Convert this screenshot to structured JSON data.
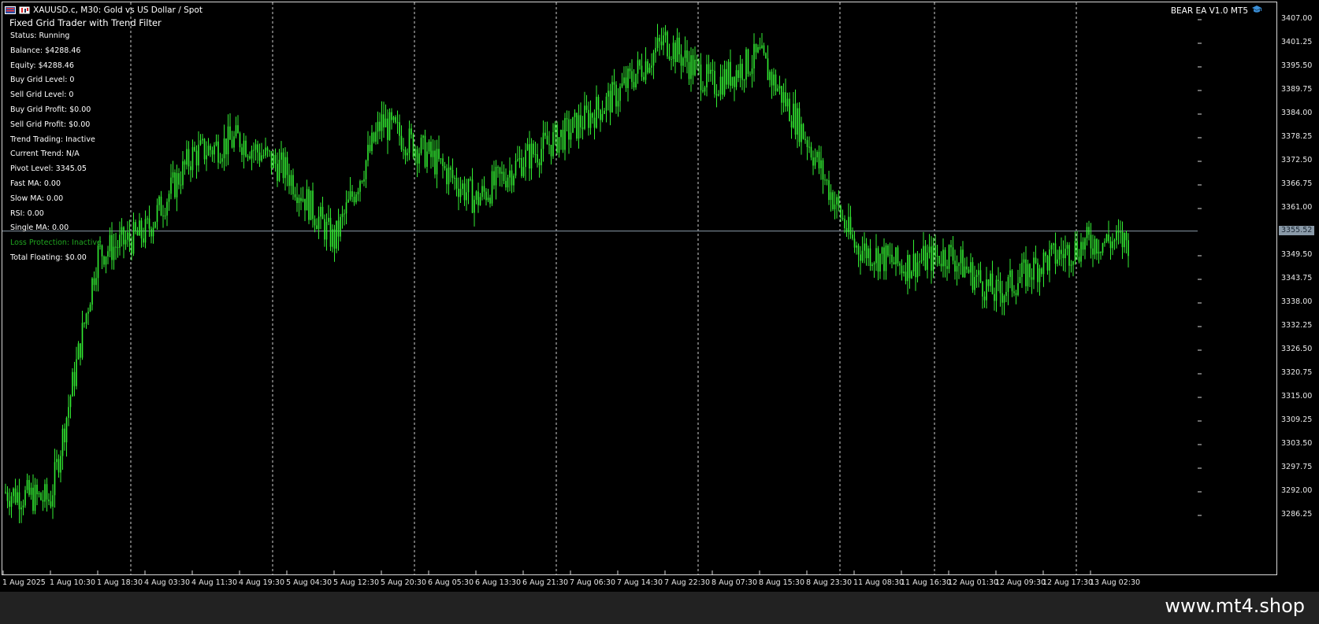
{
  "window": {
    "symbol_title": "XAUUSD.c, M30:  Gold vs US Dollar / Spot",
    "ea_badge": "BEAR EA V1.0 MT5",
    "symbol_icon": "chart-flag-icon",
    "cap_icon": "graduation-cap-icon"
  },
  "ea_panel": {
    "title": "Fixed Grid Trader with Trend Filter",
    "lines": [
      {
        "text": "Status: Running",
        "color": "#ffffff"
      },
      {
        "text": "Balance: $4288.46",
        "color": "#ffffff"
      },
      {
        "text": "Equity: $4288.46",
        "color": "#ffffff"
      },
      {
        "text": "Buy Grid Level: 0",
        "color": "#ffffff"
      },
      {
        "text": "Sell Grid Level: 0",
        "color": "#ffffff"
      },
      {
        "text": "Buy Grid Profit: $0.00",
        "color": "#ffffff"
      },
      {
        "text": "Sell Grid Profit: $0.00",
        "color": "#ffffff"
      },
      {
        "text": "Trend Trading: Inactive",
        "color": "#ffffff"
      },
      {
        "text": "Current Trend: N/A",
        "color": "#ffffff"
      },
      {
        "text": "Pivot Level: 3345.05",
        "color": "#ffffff"
      },
      {
        "text": "Fast MA: 0.00",
        "color": "#ffffff"
      },
      {
        "text": "Slow MA: 0.00",
        "color": "#ffffff"
      },
      {
        "text": "RSI: 0.00",
        "color": "#ffffff"
      },
      {
        "text": "Single MA: 0.00",
        "color": "#ffffff"
      },
      {
        "text": "Loss Protection: Inactive",
        "color": "#1fa31f"
      },
      {
        "text": "Total Floating: $0.00",
        "color": "#ffffff"
      }
    ]
  },
  "price_axis": {
    "labels": [
      "3407.00",
      "3401.25",
      "3395.50",
      "3389.75",
      "3384.00",
      "3378.25",
      "3372.50",
      "3366.75",
      "3361.00",
      "3349.50",
      "3343.75",
      "3338.00",
      "3332.25",
      "3326.50",
      "3320.75",
      "3315.00",
      "3309.25",
      "3303.50",
      "3297.75",
      "3292.00",
      "3286.25"
    ],
    "values": [
      3407.0,
      3401.25,
      3395.5,
      3389.75,
      3384.0,
      3378.25,
      3372.5,
      3366.75,
      3361.0,
      3349.5,
      3343.75,
      3338.0,
      3332.25,
      3326.5,
      3320.75,
      3315.0,
      3309.25,
      3303.5,
      3297.75,
      3292.0,
      3286.25
    ],
    "current_price": "3355.52",
    "current_value": 3355.52,
    "line_color": "#8a9aa8"
  },
  "time_axis": {
    "labels": [
      "1 Aug 2025",
      "1 Aug 10:30",
      "1 Aug 18:30",
      "4 Aug 03:30",
      "4 Aug 11:30",
      "4 Aug 19:30",
      "5 Aug 04:30",
      "5 Aug 12:30",
      "5 Aug 20:30",
      "6 Aug 05:30",
      "6 Aug 13:30",
      "6 Aug 21:30",
      "7 Aug 06:30",
      "7 Aug 14:30",
      "7 Aug 22:30",
      "8 Aug 07:30",
      "8 Aug 15:30",
      "8 Aug 23:30",
      "11 Aug 08:30",
      "11 Aug 16:30",
      "12 Aug 01:30",
      "12 Aug 09:30",
      "12 Aug 17:30",
      "13 Aug 02:30"
    ],
    "day_separators": [
      "1 Aug 18:30",
      "4 Aug 19:30",
      "5 Aug 20:30",
      "6 Aug 21:30",
      "7 Aug 22:30",
      "8 Aug 23:30",
      "11 Aug 16:30",
      "12 Aug 17:30"
    ]
  },
  "chart_data": {
    "type": "line",
    "title": "XAUUSD.c, M30:  Gold vs US Dollar / Spot",
    "xlabel": "",
    "ylabel": "",
    "ylim": [
      3281.5,
      3411.5
    ],
    "grid": "vertical day separators",
    "candle_color": "#33ee33",
    "series": [
      {
        "x_labels_ref": "time_axis.labels",
        "approx_close_at_labels": [
          3292,
          3290,
          3350,
          3355,
          3374,
          3378,
          3370,
          3353,
          3382,
          3374,
          3363,
          3373,
          3380,
          3389,
          3402,
          3391,
          3398,
          3378,
          3352,
          3347,
          3350,
          3340,
          3348,
          3353
        ]
      }
    ],
    "last_price": 3355.52
  },
  "footer": {
    "watermark": "www.mt4.shop"
  }
}
